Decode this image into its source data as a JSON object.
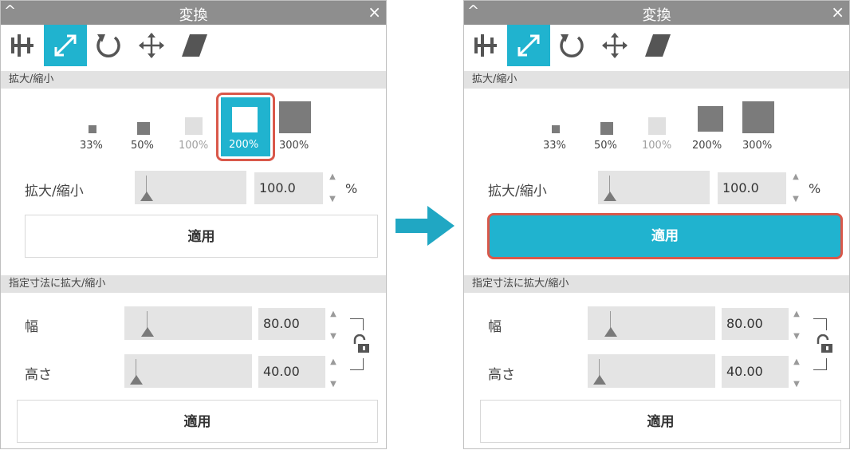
{
  "window": {
    "title": "変換",
    "collapse_icon": "^",
    "close_icon": "×"
  },
  "toolbar": {
    "tools": [
      "align-icon",
      "scale-icon",
      "rotate-icon",
      "move-icon",
      "shear-icon"
    ],
    "active": "scale-icon"
  },
  "scale_section": {
    "header": "拡大/縮小"
  },
  "presets": [
    {
      "label": "33%"
    },
    {
      "label": "50%"
    },
    {
      "label": "100%"
    },
    {
      "label": "200%"
    },
    {
      "label": "300%"
    }
  ],
  "scale_row": {
    "label": "拡大/縮小",
    "value": "100.0",
    "unit": "%"
  },
  "apply_label": "適用",
  "dimension_section": {
    "header": "指定寸法に拡大/縮小"
  },
  "width_row": {
    "label": "幅",
    "value": "80.00"
  },
  "height_row": {
    "label": "高さ",
    "value": "40.00"
  },
  "colors": {
    "accent": "#20b3cf",
    "highlight": "#d9584a",
    "titlebar": "#8e8e8e"
  }
}
